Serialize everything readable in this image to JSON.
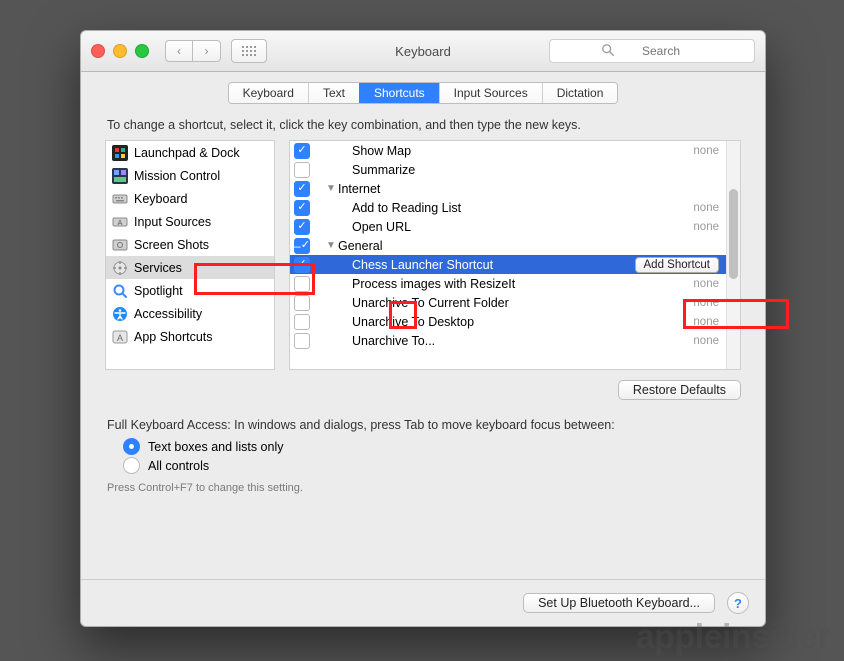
{
  "window": {
    "title": "Keyboard"
  },
  "toolbar": {
    "back_aria": "Back",
    "fwd_aria": "Forward",
    "grid_aria": "Show All"
  },
  "search": {
    "placeholder": "Search"
  },
  "tabs": [
    "Keyboard",
    "Text",
    "Shortcuts",
    "Input Sources",
    "Dictation"
  ],
  "active_tab": 2,
  "instruction": "To change a shortcut, select it, click the key combination, and then type the new keys.",
  "sidebar": {
    "selected": 5,
    "items": [
      {
        "label": "Launchpad & Dock",
        "icon": "launchpad"
      },
      {
        "label": "Mission Control",
        "icon": "mission"
      },
      {
        "label": "Keyboard",
        "icon": "keyboard"
      },
      {
        "label": "Input Sources",
        "icon": "input"
      },
      {
        "label": "Screen Shots",
        "icon": "screenshot"
      },
      {
        "label": "Services",
        "icon": "services"
      },
      {
        "label": "Spotlight",
        "icon": "spotlight"
      },
      {
        "label": "Accessibility",
        "icon": "accessibility"
      },
      {
        "label": "App Shortcuts",
        "icon": "appshort"
      }
    ]
  },
  "services": {
    "rows": [
      {
        "type": "item",
        "level": 2,
        "checked": true,
        "label": "Show Map",
        "shortcut": "none"
      },
      {
        "type": "item",
        "level": 2,
        "checked": false,
        "label": "Summarize",
        "shortcut": ""
      },
      {
        "type": "group",
        "level": 1,
        "checked": true,
        "label": "Internet"
      },
      {
        "type": "item",
        "level": 2,
        "checked": true,
        "label": "Add to Reading List",
        "shortcut": "none"
      },
      {
        "type": "item",
        "level": 2,
        "checked": true,
        "label": "Open URL",
        "shortcut": "none"
      },
      {
        "type": "group",
        "level": 1,
        "checked": "mixed",
        "label": "General"
      },
      {
        "type": "item",
        "level": 2,
        "checked": true,
        "label": "Chess Launcher Shortcut",
        "shortcut": "",
        "selected": true,
        "add_button": true
      },
      {
        "type": "item",
        "level": 2,
        "checked": false,
        "label": "Process images with ResizeIt",
        "shortcut": "none"
      },
      {
        "type": "item",
        "level": 2,
        "checked": false,
        "label": "Unarchive To Current Folder",
        "shortcut": "none"
      },
      {
        "type": "item",
        "level": 2,
        "checked": false,
        "label": "Unarchive To Desktop",
        "shortcut": "none"
      },
      {
        "type": "item",
        "level": 2,
        "checked": false,
        "label": "Unarchive To...",
        "shortcut": "none"
      }
    ],
    "add_shortcut_label": "Add Shortcut"
  },
  "buttons": {
    "restore": "Restore Defaults",
    "bluetooth": "Set Up Bluetooth Keyboard..."
  },
  "access": {
    "heading": "Full Keyboard Access: In windows and dialogs, press Tab to move keyboard focus between:",
    "opt1": "Text boxes and lists only",
    "opt2": "All controls",
    "hint": "Press Control+F7 to change this setting."
  },
  "watermark": "appleinsider"
}
